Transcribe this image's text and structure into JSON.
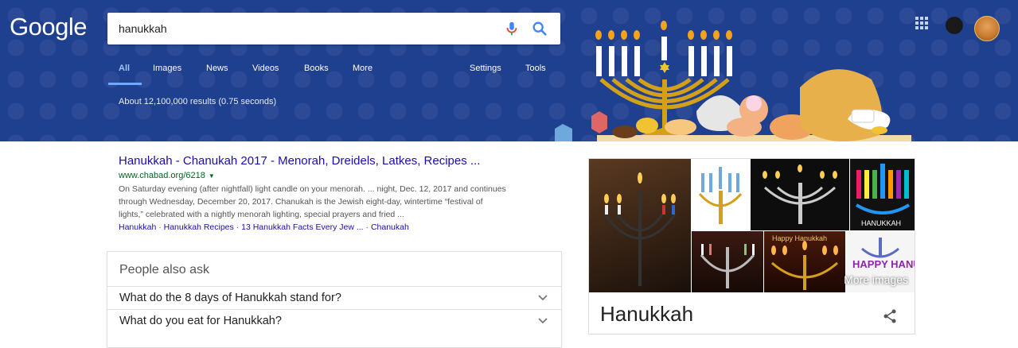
{
  "header": {
    "logo_text": "Google",
    "search_value": "hanukkah",
    "tabs": [
      {
        "label": "All",
        "active": true
      },
      {
        "label": "Images"
      },
      {
        "label": "News"
      },
      {
        "label": "Videos"
      },
      {
        "label": "Books"
      },
      {
        "label": "More"
      }
    ],
    "settings_label": "Settings",
    "tools_label": "Tools",
    "stats": "About 12,100,000 results (0.75 seconds)",
    "accent_color": "#1f3f8f"
  },
  "result": {
    "title": "Hanukkah - Chanukah 2017 - Menorah, Dreidels, Latkes, Recipes ...",
    "url": "www.chabad.org/6218",
    "snippet_1": "On Saturday evening (after nightfall) light candle on your menorah. ... night, Dec. 12, 2017 and continues",
    "snippet_2": "through Wednesday, December 20, 2017. Chanukah is the Jewish eight-day, wintertime “festival of",
    "snippet_3": "lights,” celebrated with a nightly menorah lighting, special prayers and fried ...",
    "links": [
      "Hanukkah",
      "Hanukkah Recipes",
      "13 Hanukkah Facts Every Jew ...",
      "Chanukah"
    ]
  },
  "paa": {
    "title": "People also ask",
    "questions": [
      "What do the 8 days of Hanukkah stand for?",
      "What do you eat for Hanukkah?"
    ]
  },
  "knowledge_panel": {
    "title": "Hanukkah",
    "more_images": "More images",
    "image_captions": [
      "Happy Hanukkah",
      "HANUKKAH",
      "HAPPY HANUKKAH"
    ]
  }
}
